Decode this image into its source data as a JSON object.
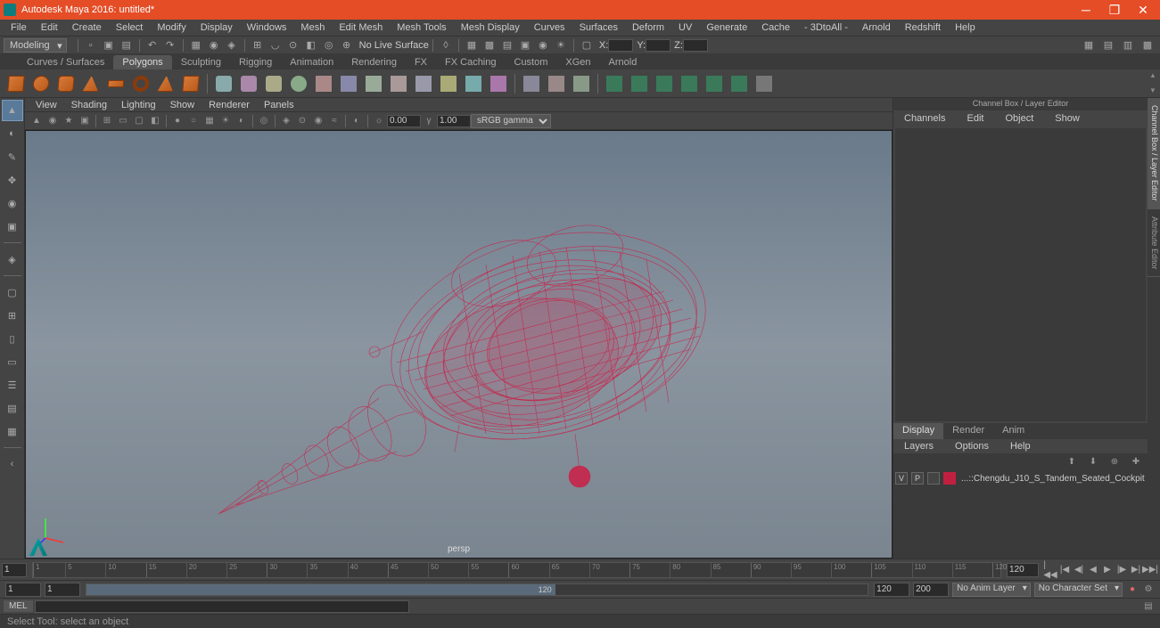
{
  "title": "Autodesk Maya 2016: untitled*",
  "menus": [
    "File",
    "Edit",
    "Create",
    "Select",
    "Modify",
    "Display",
    "Windows",
    "Mesh",
    "Edit Mesh",
    "Mesh Tools",
    "Mesh Display",
    "Curves",
    "Surfaces",
    "Deform",
    "UV",
    "Generate",
    "Cache",
    "- 3DtoAll -",
    "Arnold",
    "Redshift",
    "Help"
  ],
  "workspace_mode": "Modeling",
  "no_live_surface": "No Live Surface",
  "coord_labels": {
    "x": "X:",
    "y": "Y:",
    "z": "Z:"
  },
  "shelf_tabs": [
    "Curves / Surfaces",
    "Polygons",
    "Sculpting",
    "Rigging",
    "Animation",
    "Rendering",
    "FX",
    "FX Caching",
    "Custom",
    "XGen",
    "Arnold"
  ],
  "shelf_active": "Polygons",
  "panel_menus": [
    "View",
    "Shading",
    "Lighting",
    "Show",
    "Renderer",
    "Panels"
  ],
  "panel_gamma": "sRGB gamma",
  "panel_vals": {
    "a": "0.00",
    "b": "1.00"
  },
  "persp": "persp",
  "channel_header": "Channel Box / Layer Editor",
  "channel_menus": [
    "Channels",
    "Edit",
    "Object",
    "Show"
  ],
  "vtabs": [
    "Channel Box / Layer Editor",
    "Attribute Editor"
  ],
  "layer_tabs": [
    "Display",
    "Render",
    "Anim"
  ],
  "layer_menus": [
    "Layers",
    "Options",
    "Help"
  ],
  "layer_row": {
    "v": "V",
    "p": "P",
    "name": "...::Chengdu_J10_S_Tandem_Seated_Cockpit"
  },
  "timeline": {
    "start": "1",
    "end": "120",
    "ticks": [
      1,
      15,
      30,
      45,
      60,
      75,
      90,
      105,
      120
    ],
    "tick_labels": [
      "1",
      "15",
      "30",
      "45",
      "60",
      "75",
      "90",
      "105",
      "120"
    ]
  },
  "range": {
    "in": "1",
    "out": "120",
    "start": "1",
    "end": "200",
    "cur": "120"
  },
  "anim_layer": "No Anim Layer",
  "char_set": "No Character Set",
  "cmd_lang": "MEL",
  "help_text": "Select Tool: select an object"
}
